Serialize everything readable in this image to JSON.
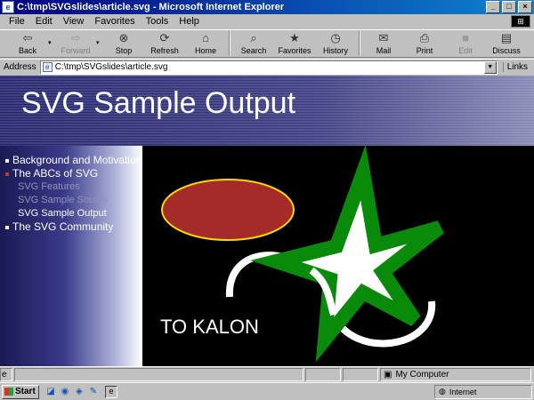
{
  "window": {
    "title": "C:\\tmp\\SVGslides\\article.svg - Microsoft Internet Explorer",
    "minimize": "_",
    "maximize": "□",
    "close": "×",
    "logo_icon": "windows-logo-icon"
  },
  "menu": [
    "File",
    "Edit",
    "View",
    "Favorites",
    "Tools",
    "Help"
  ],
  "toolbar": {
    "back": "Back",
    "forward": "Forward",
    "stop": "Stop",
    "refresh": "Refresh",
    "home": "Home",
    "search": "Search",
    "favorites": "Favorites",
    "history": "History",
    "mail": "Mail",
    "print": "Print",
    "edit": "Edit",
    "discuss": "Discuss"
  },
  "address": {
    "label": "Address",
    "value": "C:\\tmp\\SVGslides\\article.svg",
    "links": "Links"
  },
  "page": {
    "heading": "SVG Sample Output",
    "nav": [
      {
        "label": "Background and Motivation",
        "bullet_color": "#ffffff",
        "text_color": "#ffffff"
      },
      {
        "label": "The ABCs of SVG",
        "bullet_color": "#c0392b",
        "text_color": "#ffffff"
      },
      {
        "label": "SVG Features",
        "bullet_color": "",
        "text_color": "#8f93b8"
      },
      {
        "label": "SVG Sample Source",
        "bullet_color": "",
        "text_color": "#8f93b8"
      },
      {
        "label": "SVG Sample Output",
        "bullet_color": "",
        "text_color": "#ffffff"
      },
      {
        "label": "The SVG Community",
        "bullet_color": "#ffffff",
        "text_color": "#ffffff"
      }
    ],
    "slide_text": "TO KALON",
    "colors": {
      "ellipse_fill": "#a52a2a",
      "ellipse_stroke": "#ffd700",
      "star_fill": "#ffffff",
      "star_stroke": "#0a8a0a",
      "path_stroke": "#ffffff"
    }
  },
  "status": {
    "text": "",
    "zone": "My Computer"
  },
  "taskbar": {
    "start": "Start",
    "tray_text": "Internet"
  }
}
